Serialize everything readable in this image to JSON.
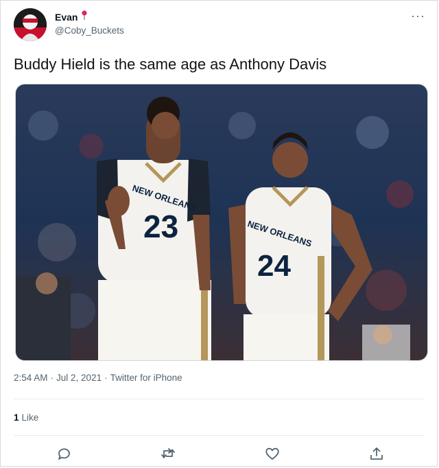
{
  "user": {
    "display_name": "Evan",
    "name_emoji": "pin-icon",
    "handle": "@Coby_Buckets"
  },
  "tweet": {
    "text": "Buddy Hield is the same age as Anthony Davis",
    "time": "2:54 AM",
    "separator": "·",
    "date": "Jul 2, 2021",
    "source": "Twitter for iPhone"
  },
  "media": {
    "jersey_left": {
      "team": "NEW ORLEANS",
      "number": "23"
    },
    "jersey_right": {
      "team": "NEW ORLEANS",
      "number": "24"
    }
  },
  "engagement": {
    "like_count": "1",
    "like_label": "Like"
  },
  "actions": [
    "reply-icon",
    "retweet-icon",
    "like-icon",
    "share-icon"
  ],
  "colors": {
    "text": "#0f1419",
    "secondary": "#536471",
    "pelicans_navy": "#0c2340",
    "pelicans_gold": "#b4975a"
  }
}
